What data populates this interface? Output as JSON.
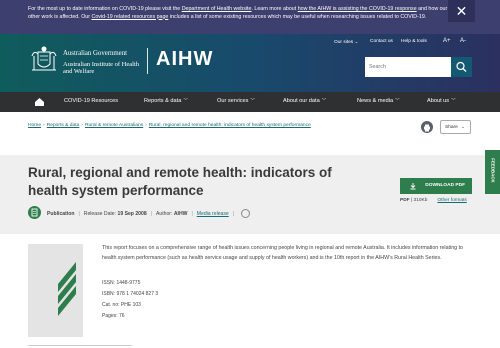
{
  "alert": {
    "text_1": "For the most up to date information on COVID-19 please visit the ",
    "link_1": "Department of Health website",
    "text_2": ". Learn more about ",
    "link_2": "how the AIHW is assisting the COVID-19 response",
    "text_3": " and how our other work is affected. Our ",
    "link_3": "Covid-19 related resources page",
    "text_4": " includes a list of some existing resources which may be useful when researching issues related to COVID-19.",
    "close_icon": "close-icon"
  },
  "header": {
    "gov_name": "Australian Government",
    "inst_name": "Australian Institute of Health and Welfare",
    "logo_text": "AIHW",
    "utility": {
      "our_sites": "Our sites",
      "contact": "Contact us",
      "help": "Help & tools",
      "font_larger": "A+",
      "font_smaller": "A-"
    },
    "search_placeholder": "Search"
  },
  "nav": {
    "home_icon": "home-icon",
    "items": [
      {
        "label": "COVID-19 Resources",
        "has_dropdown": false
      },
      {
        "label": "Reports & data",
        "has_dropdown": true
      },
      {
        "label": "Our services",
        "has_dropdown": true
      },
      {
        "label": "About our data",
        "has_dropdown": true
      },
      {
        "label": "News & media",
        "has_dropdown": true
      },
      {
        "label": "About us",
        "has_dropdown": true
      }
    ]
  },
  "breadcrumb": {
    "items": [
      "Home",
      "Reports & data",
      "Rural & remote Australians",
      "Rural, regional and remote health: indicators of health system performance"
    ]
  },
  "actions": {
    "share_label": "Share"
  },
  "publication": {
    "title": "Rural, regional and remote health: indicators of health system performance",
    "type": "Publication",
    "release_label": "Release Date:",
    "release_date": "19 Sep 2008",
    "author_label": "Author:",
    "author": "AIHW",
    "media_release": "Media release",
    "download_label": "DOWNLOAD PDF",
    "file_type": "PDF",
    "file_size": "310Kb",
    "other_formats": "Other formats",
    "summary": "This report focuses on a comprehensive range of health issues concerning people living in regional and remote Australia. It includes information relating to health system performance (such as health service usage and supply of health workers) and is the 10th report in the AIHW's Rural Health Series.",
    "issn_label": "ISSN:",
    "issn": "1448-9775",
    "isbn_label": "ISBN:",
    "isbn": "978 1 74024 827 3",
    "cat_label": "Cat. no:",
    "cat_no": "PHE 103",
    "pages_label": "Pages:",
    "pages": "76"
  },
  "feedback": {
    "label": "FEEDBACK"
  },
  "colors": {
    "alert_bg": "#3d3f6e",
    "nav_bg": "#2f3031",
    "accent_green": "#2e7d4c",
    "link": "#1a6a72"
  }
}
